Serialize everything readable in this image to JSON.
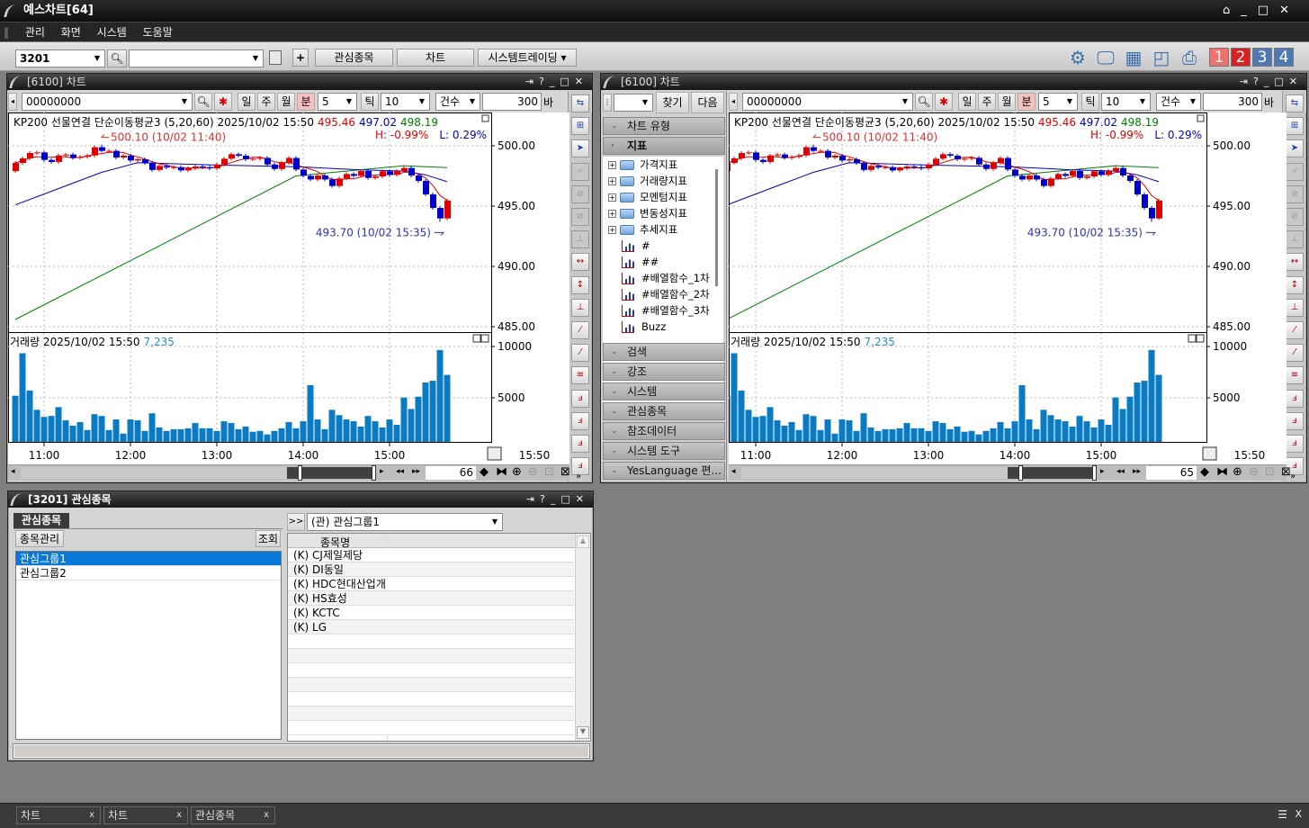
{
  "app": {
    "title": "예스차트[64]"
  },
  "menu": [
    "관리",
    "화면",
    "시스템",
    "도움말"
  ],
  "toolbar": {
    "screen_code": "3201",
    "screen_name": "",
    "buttons": [
      "관심종목",
      "차트",
      "시스템트레이딩"
    ],
    "right_icons": [
      "gear-icon",
      "monitor-icon",
      "layout-icon",
      "window-icon",
      "printer-icon"
    ],
    "pages": [
      "1",
      "2",
      "3",
      "4"
    ],
    "page_colors": [
      "#f07070",
      "#d82020",
      "#4f79b3",
      "#4f79b3"
    ]
  },
  "charts": [
    {
      "title": "[6100] 차트",
      "code": "00000000",
      "periods": [
        "일",
        "주",
        "월",
        "분"
      ],
      "period_value": "5",
      "tick_label": "틱",
      "tick_value": "10",
      "count_type": "건수",
      "count_value": "300",
      "count_unit": "바",
      "scroll_value": "66"
    },
    {
      "title": "[6100] 차트",
      "code": "00000000",
      "periods": [
        "일",
        "주",
        "월",
        "분"
      ],
      "period_value": "5",
      "tick_label": "틱",
      "tick_value": "10",
      "count_type": "건수",
      "count_value": "300",
      "count_unit": "바",
      "scroll_value": "65",
      "sidebar": {
        "find": "찾기",
        "next": "다음",
        "sections_top": [
          "차트 유형",
          "지표"
        ],
        "tree": [
          {
            "type": "folder",
            "label": "가격지표"
          },
          {
            "type": "folder",
            "label": "거래량지표"
          },
          {
            "type": "folder",
            "label": "모멘텀지표"
          },
          {
            "type": "folder",
            "label": "변동성지표"
          },
          {
            "type": "folder",
            "label": "추세지표"
          },
          {
            "type": "indicator",
            "label": "#"
          },
          {
            "type": "indicator",
            "label": "##"
          },
          {
            "type": "indicator",
            "label": "#배열함수_1차"
          },
          {
            "type": "indicator",
            "label": "#배열함수_2차"
          },
          {
            "type": "indicator",
            "label": "#배열함수_3차"
          },
          {
            "type": "indicator",
            "label": "Buzz"
          }
        ],
        "sections_bottom": [
          "검색",
          "강조",
          "시스템",
          "관심종목",
          "참조데이터",
          "시스템 도구",
          "YesLanguage 편..."
        ]
      }
    }
  ],
  "chart_data": {
    "type": "candlestick",
    "price_header": {
      "label": "KP200 선물연결 단순이동평균3  (5,20,60) 2025/10/02 15:50",
      "ma5": "495.46",
      "ma20": "497.02",
      "ma60": "498.19",
      "high_pct": "H: -0.99%",
      "low_pct": "L: 0.29%"
    },
    "volume_header": {
      "label": "거래량  2025/10/02 15:50",
      "value": "7,235"
    },
    "interval_minutes": 5,
    "start_time": "10:40",
    "price_ticks": [
      "500.00",
      "495.00",
      "490.00",
      "485.00"
    ],
    "volume_ticks": [
      "10000",
      "5000"
    ],
    "time_ticks": [
      "11:00",
      "12:00",
      "13:00",
      "14:00",
      "15:00"
    ],
    "last_time_label": "15:50",
    "close": [
      498.58,
      498.96,
      499.4,
      499.45,
      498.83,
      498.66,
      499.2,
      499.28,
      499.0,
      499.08,
      499.2,
      499.88,
      499.58,
      499.58,
      499.03,
      499.18,
      498.78,
      498.88,
      498.58,
      498.0,
      498.33,
      498.2,
      498.23,
      497.96,
      498.13,
      498.28,
      498.23,
      498.13,
      498.45,
      498.93,
      499.3,
      499.18,
      498.88,
      498.93,
      499.0,
      498.45,
      498.08,
      498.58,
      498.99,
      498.03,
      497.51,
      497.21,
      497.53,
      497.21,
      496.67,
      497.29,
      497.66,
      497.51,
      497.91,
      497.34,
      497.46,
      497.89,
      497.59,
      497.91,
      498.16,
      497.54,
      497.09,
      495.97,
      494.85,
      493.98,
      495.46
    ],
    "first_open": 497.9,
    "volume": [
      5200,
      9340,
      5710,
      3830,
      3140,
      3230,
      4090,
      2800,
      2290,
      2630,
      1860,
      3400,
      3230,
      1860,
      2890,
      1510,
      2890,
      2800,
      1770,
      3490,
      2110,
      1770,
      1940,
      1940,
      2030,
      2540,
      2030,
      2030,
      1770,
      2710,
      2540,
      1940,
      2200,
      1690,
      1770,
      1430,
      1770,
      2030,
      2630,
      2030,
      2710,
      6230,
      2890,
      1940,
      3830,
      3310,
      2890,
      2710,
      2200,
      3230,
      2710,
      2110,
      2890,
      2370,
      5030,
      3910,
      5110,
      6490,
      6660,
      9660,
      7235
    ],
    "ma20": [
      [
        "10:40",
        495.1
      ],
      [
        "11:00",
        496.0
      ],
      [
        "11:20",
        496.9
      ],
      [
        "11:40",
        497.8
      ],
      [
        "12:05",
        498.6
      ],
      [
        "13:00",
        498.4
      ],
      [
        "14:00",
        498.25
      ],
      [
        "14:40",
        498.0
      ],
      [
        "15:10",
        497.9
      ],
      [
        "15:25",
        497.6
      ],
      [
        "15:40",
        497.02
      ]
    ],
    "ma60": [
      [
        "10:40",
        485.6
      ],
      [
        "13:55",
        497.5
      ],
      [
        "14:30",
        497.9
      ],
      [
        "15:10",
        498.35
      ],
      [
        "15:40",
        498.19
      ]
    ],
    "annotations": [
      {
        "text": "500.10 (10/02 11:40)",
        "time": "11:40",
        "price": 500.1,
        "kind": "high"
      },
      {
        "text": "493.70 (10/02 15:35)",
        "time": "15:35",
        "price": 493.7,
        "kind": "low"
      }
    ],
    "colors": {
      "up": "#e00000",
      "down": "#0000cc",
      "volume": "#0a7bc2",
      "ma5": "#e00000",
      "ma20": "#0000c0",
      "ma60": "#008000"
    },
    "grid": true
  },
  "watchlist": {
    "title": "[3201] 관심종목",
    "tab": "관심종목",
    "manage_button": "종목관리",
    "query_button": "조회",
    "groups": [
      "관심그룹1",
      "관심그룹2"
    ],
    "selected_group": "(관) 관심그룹1",
    "expand_button": ">>",
    "column_header": "종목명",
    "items": [
      "(K) CJ제일제당",
      "(K) DI동일",
      "(K) HDC현대산업개",
      "(K) HS효성",
      "(K) KCTC",
      "(K) LG"
    ]
  },
  "taskbar": {
    "tabs": [
      "차트",
      "차트",
      "관심종목"
    ],
    "close": "x"
  }
}
